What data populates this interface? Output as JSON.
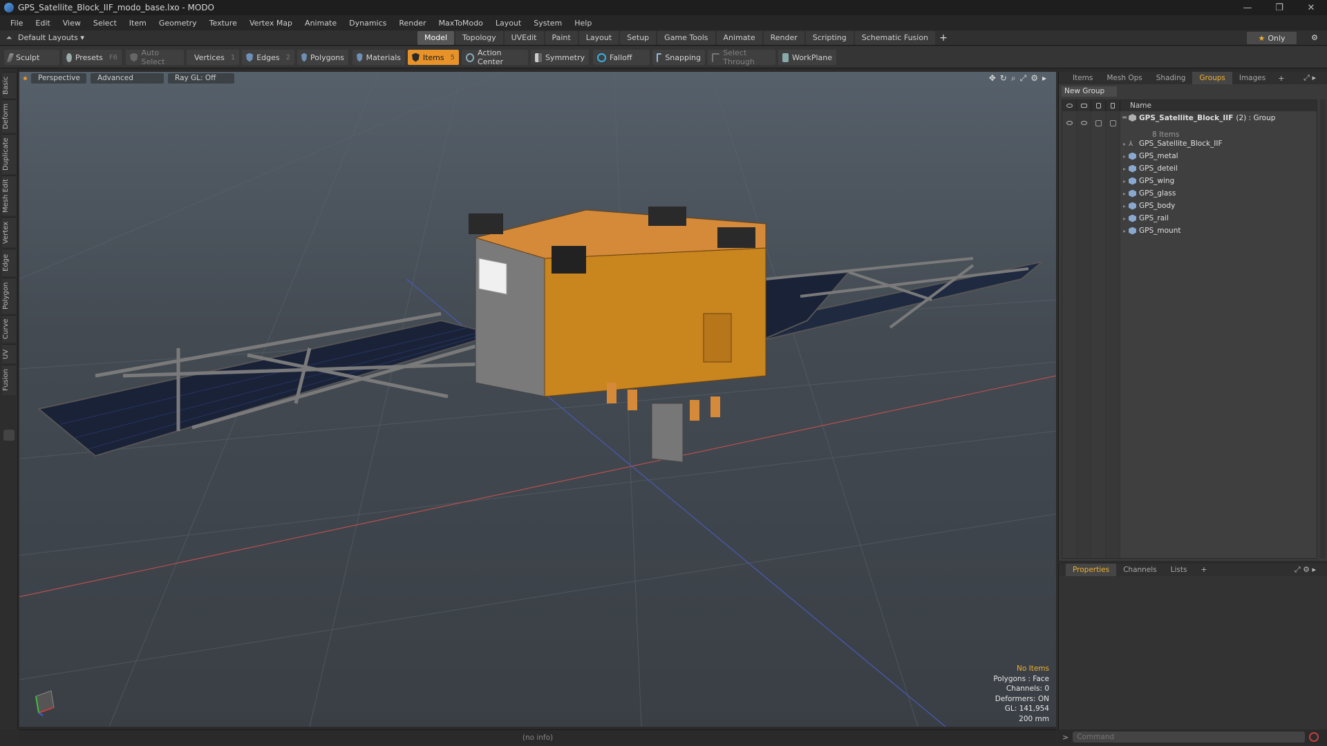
{
  "window": {
    "title": "GPS_Satellite_Block_IIF_modo_base.lxo - MODO",
    "controls": [
      "—",
      "❐",
      "✕"
    ]
  },
  "menu": [
    "File",
    "Edit",
    "View",
    "Select",
    "Item",
    "Geometry",
    "Texture",
    "Vertex Map",
    "Animate",
    "Dynamics",
    "Render",
    "MaxToModo",
    "Layout",
    "System",
    "Help"
  ],
  "layoutbar": {
    "layouts_label": "Default Layouts",
    "tabs": [
      "Model",
      "Topology",
      "UVEdit",
      "Paint",
      "Layout",
      "Setup",
      "Game Tools",
      "Animate",
      "Render",
      "Scripting",
      "Schematic Fusion"
    ],
    "active_tab": "Model",
    "only_label": "Only"
  },
  "toolbar": {
    "sculpt": "Sculpt",
    "presets": "Presets",
    "presets_key": "F6",
    "auto_select": "Auto Select",
    "vertices": "Vertices",
    "vertices_key": "1",
    "edges": "Edges",
    "edges_key": "2",
    "polygons": "Polygons",
    "materials": "Materials",
    "items": "Items",
    "items_key": "5",
    "action_center": "Action Center",
    "symmetry": "Symmetry",
    "falloff": "Falloff",
    "snapping": "Snapping",
    "select_through": "Select Through",
    "workplane": "WorkPlane"
  },
  "left_tabs": [
    "Basic",
    "Deform",
    "Duplicate",
    "Mesh Edit",
    "Vertex",
    "Edge",
    "Polygon",
    "Curve",
    "UV",
    "Fusion"
  ],
  "viewport": {
    "view": "Perspective",
    "shading": "Advanced",
    "raygl": "Ray GL: Off",
    "info": {
      "no_items": "No Items",
      "polygons": "Polygons : Face",
      "channels": "Channels: 0",
      "deformers": "Deformers: ON",
      "gl": "GL: 141,954",
      "scale": "200 mm"
    }
  },
  "statusbar": "(no info)",
  "right_panel": {
    "tabs": [
      "Items",
      "Mesh Ops",
      "Shading",
      "Groups",
      "Images"
    ],
    "active_tab": "Groups",
    "new_group": "New Group",
    "column_name": "Name",
    "group": {
      "name": "GPS_Satellite_Block_IIF",
      "meta": "(2) : Group",
      "count": "8 Items"
    },
    "items": [
      {
        "name": "GPS_Satellite_Block_IIF",
        "icon": "locator-icon"
      },
      {
        "name": "GPS_metal",
        "icon": "mesh-icon"
      },
      {
        "name": "GPS_deteil",
        "icon": "mesh-icon"
      },
      {
        "name": "GPS_wing",
        "icon": "mesh-icon"
      },
      {
        "name": "GPS_glass",
        "icon": "mesh-icon"
      },
      {
        "name": "GPS_body",
        "icon": "mesh-icon"
      },
      {
        "name": "GPS_rail",
        "icon": "mesh-icon"
      },
      {
        "name": "GPS_mount",
        "icon": "mesh-icon"
      }
    ]
  },
  "properties_panel": {
    "tabs": [
      "Properties",
      "Channels",
      "Lists"
    ],
    "active_tab": "Properties"
  },
  "command": {
    "placeholder": "Command"
  },
  "colors": {
    "accent": "#e8922a",
    "active_tab_text": "#f0b030"
  }
}
